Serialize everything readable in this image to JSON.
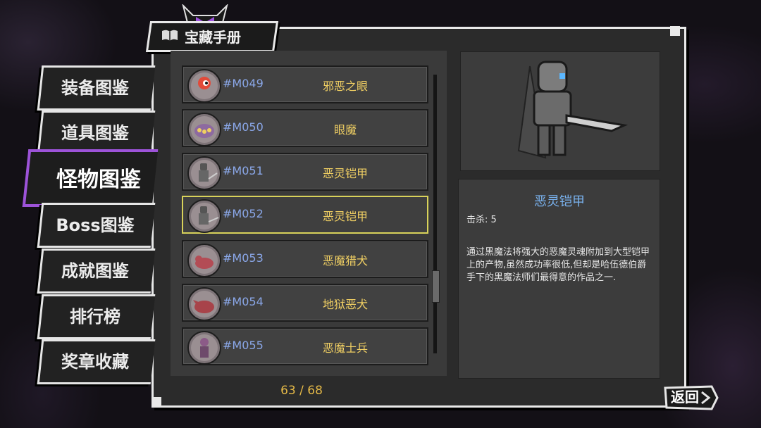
{
  "header": {
    "title": "宝藏手册"
  },
  "nav": {
    "items": [
      {
        "label": "装备图鉴",
        "active": false
      },
      {
        "label": "道具图鉴",
        "active": false
      },
      {
        "label": "怪物图鉴",
        "active": true
      },
      {
        "label": "Boss图鉴",
        "active": false
      },
      {
        "label": "成就图鉴",
        "active": false
      },
      {
        "label": "排行榜",
        "active": false
      },
      {
        "label": "奖章收藏",
        "active": false
      }
    ]
  },
  "list": {
    "rows": [
      {
        "id": "#M049",
        "name": "邪恶之眼",
        "icon": "evil-eye-icon"
      },
      {
        "id": "#M050",
        "name": "眼魔",
        "icon": "eye-demon-icon"
      },
      {
        "id": "#M051",
        "name": "恶灵铠甲",
        "icon": "wraith-armor-icon"
      },
      {
        "id": "#M052",
        "name": "恶灵铠甲",
        "icon": "wraith-armor-icon",
        "selected": true
      },
      {
        "id": "#M053",
        "name": "恶魔猎犬",
        "icon": "demon-hound-icon"
      },
      {
        "id": "#M054",
        "name": "地狱恶犬",
        "icon": "hellhound-icon"
      },
      {
        "id": "#M055",
        "name": "恶魔士兵",
        "icon": "demon-soldier-icon"
      }
    ],
    "page": "63 / 68"
  },
  "detail": {
    "name": "恶灵铠甲",
    "kills": "击杀: 5",
    "description": "通过黑魔法将强大的恶魔灵魂附加到大型铠甲上的产物,虽然成功率很低,但却是哈伍德伯爵手下的黑魔法师们最得意的作品之一."
  },
  "buttons": {
    "back": "返回"
  },
  "colors": {
    "accent": "#9d53d9",
    "selection": "#d8d25a",
    "id_text": "#8aa7e8",
    "name_text": "#f0cf63",
    "detail_title": "#7ab3f0",
    "page_text": "#e5b947"
  }
}
